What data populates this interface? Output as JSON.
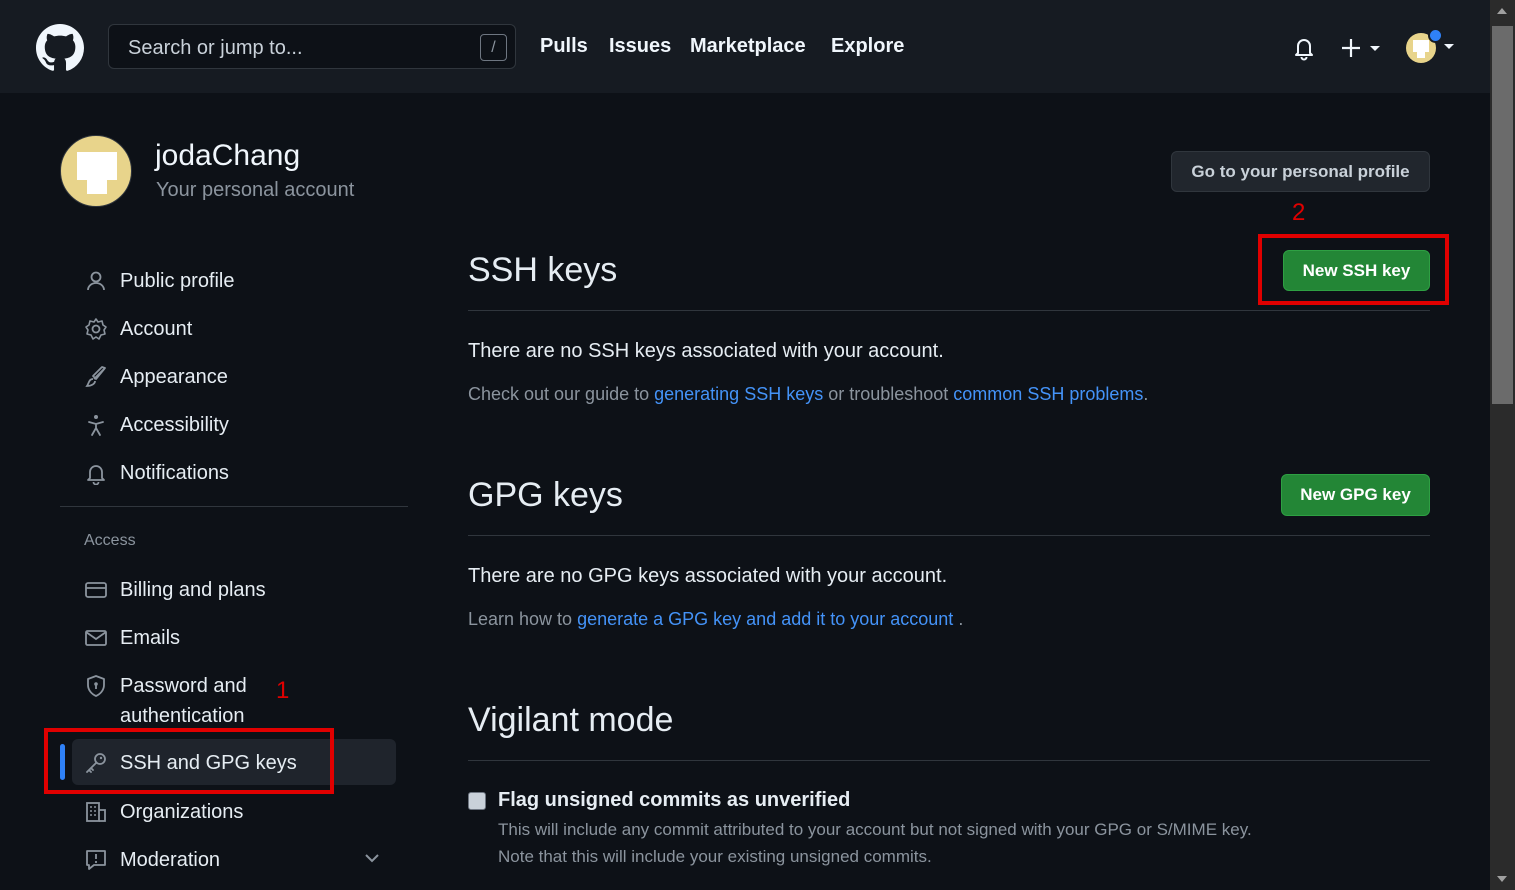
{
  "header": {
    "search_placeholder": "Search or jump to...",
    "search_shortcut": "/",
    "nav": [
      "Pulls",
      "Issues",
      "Marketplace",
      "Explore"
    ]
  },
  "user": {
    "name": "jodaChang",
    "subtitle": "Your personal account"
  },
  "profile_button": "Go to your personal profile",
  "sidebar": {
    "items": [
      {
        "label": "Public profile",
        "icon": "person-icon"
      },
      {
        "label": "Account",
        "icon": "gear-icon"
      },
      {
        "label": "Appearance",
        "icon": "paintbrush-icon"
      },
      {
        "label": "Accessibility",
        "icon": "accessibility-icon"
      },
      {
        "label": "Notifications",
        "icon": "bell-icon"
      }
    ],
    "access_heading": "Access",
    "access_items": [
      {
        "label": "Billing and plans",
        "icon": "credit-card-icon"
      },
      {
        "label": "Emails",
        "icon": "mail-icon"
      },
      {
        "label": "Password and",
        "label2": "authentication",
        "icon": "shield-icon"
      },
      {
        "label": "SSH and GPG keys",
        "icon": "key-icon",
        "active": true
      },
      {
        "label": "Organizations",
        "icon": "organization-icon"
      },
      {
        "label": "Moderation",
        "icon": "report-icon"
      }
    ]
  },
  "ssh": {
    "title": "SSH keys",
    "button": "New SSH key",
    "empty": "There are no SSH keys associated with your account.",
    "guide_prefix": "Check out our guide to ",
    "guide_link1": "generating SSH keys",
    "guide_mid": " or troubleshoot ",
    "guide_link2": "common SSH problems",
    "guide_suffix": "."
  },
  "gpg": {
    "title": "GPG keys",
    "button": "New GPG key",
    "empty": "There are no GPG keys associated with your account.",
    "learn_prefix": "Learn how to ",
    "learn_link": "generate a GPG key and add it to your account",
    "learn_suffix": " ."
  },
  "vigilant": {
    "title": "Vigilant mode",
    "checkbox_label": "Flag unsigned commits as unverified",
    "note1": "This will include any commit attributed to your account but not signed with your GPG or S/MIME key.",
    "note2": "Note that this will include your existing unsigned commits."
  },
  "annotations": {
    "step1": "1",
    "step2": "2",
    "color": "#e00000"
  },
  "colors": {
    "accent_blue": "#2f81f7",
    "button_green": "#238636",
    "link": "#4493f8"
  }
}
